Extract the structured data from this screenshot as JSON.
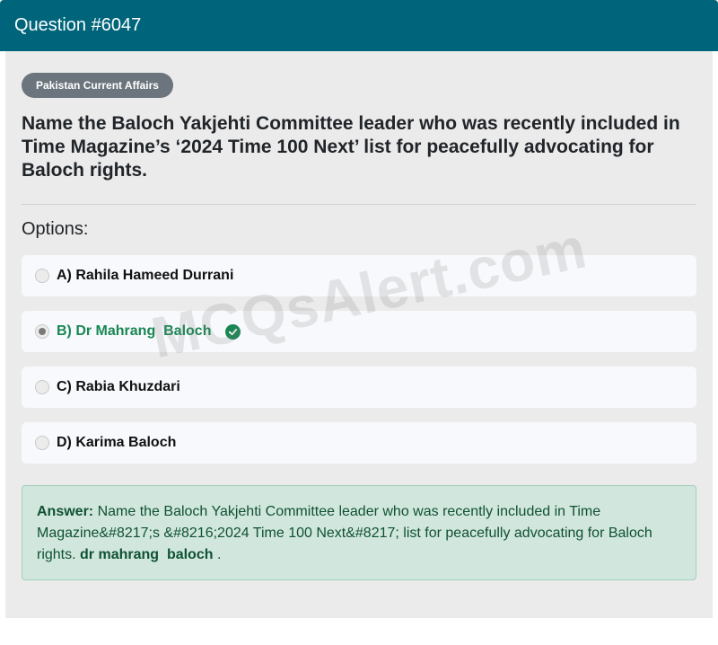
{
  "header": {
    "title": "Question #6047"
  },
  "category_badge": "Pakistan Current Affairs",
  "question": "Name the Baloch Yakjehti Committee leader who was recently included in Time Magazine’s ‘2024 Time 100 Next’ list for peacefully advocating for Baloch rights.",
  "options_label": "Options:",
  "options": [
    {
      "label": "A) Rahila Hameed Durrani",
      "selected": false,
      "correct": false
    },
    {
      "label": "B) Dr Mahrang  Baloch",
      "selected": true,
      "correct": true
    },
    {
      "label": "C) Rabia Khuzdari",
      "selected": false,
      "correct": false
    },
    {
      "label": "D) Karima Baloch",
      "selected": false,
      "correct": false
    }
  ],
  "answer": {
    "prefix": "Answer:",
    "text": "Name the Baloch Yakjehti Committee leader who was recently included in Time Magazine&#8217;s &#8216;2024 Time 100 Next&#8217; list for peacefully advocating for Baloch rights.",
    "value": "dr mahrang  baloch",
    "suffix": "."
  },
  "watermark": "MCQsAlert.com",
  "colors": {
    "header": "#00657b",
    "correct": "#198754",
    "answer_bg": "#d1e7dd"
  }
}
